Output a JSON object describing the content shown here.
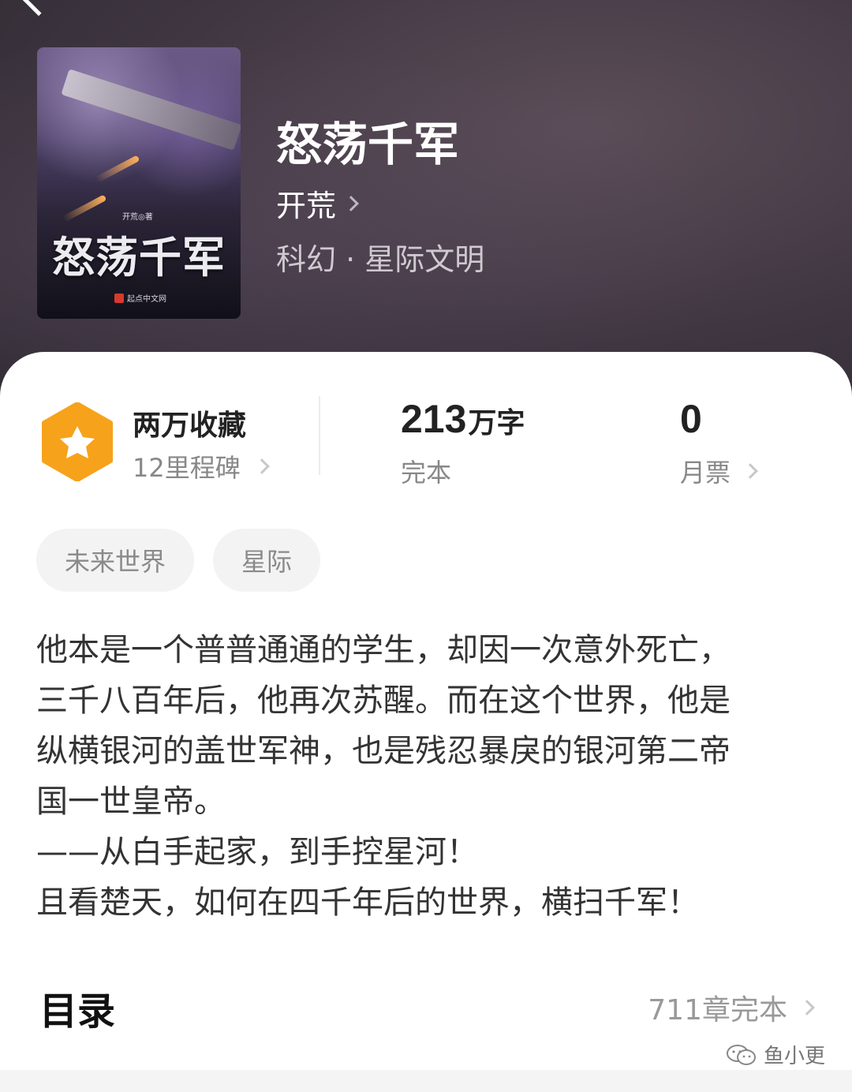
{
  "book": {
    "title": "怒荡千军",
    "author": "开荒",
    "genre": "科幻 · 星际文明",
    "cover": {
      "title": "怒荡千军",
      "author_line": "开荒◎著",
      "publisher": "起点中文网"
    }
  },
  "stats": {
    "favorites_title": "两万收藏",
    "favorites_sub": "12里程碑",
    "word_count": "213",
    "word_unit": "万字",
    "word_status": "完本",
    "monthly_tickets": "0",
    "monthly_label": "月票"
  },
  "tags": [
    "未来世界",
    "星际"
  ],
  "synopsis": [
    "他本是一个普普通通的学生，却因一次意外死亡，",
    "三千八百年后，他再次苏醒。而在这个世界，他是",
    "纵横银河的盖世军神，也是残忍暴戾的银河第二帝",
    "国一世皇帝。",
    "——从白手起家，到手控星河！",
    "且看楚天，如何在四千年后的世界，横扫千军！"
  ],
  "toc": {
    "title": "目录",
    "summary": "711章完本"
  },
  "watermark": "鱼小更",
  "colors": {
    "hero_bg": "#3e3540",
    "badge_orange": "#f7a21b",
    "text_primary": "#222222",
    "text_secondary": "#888888",
    "tag_bg": "#f3f3f3"
  },
  "icons": [
    "back-icon",
    "chevron-right-icon",
    "star-badge-icon",
    "wechat-icon"
  ]
}
